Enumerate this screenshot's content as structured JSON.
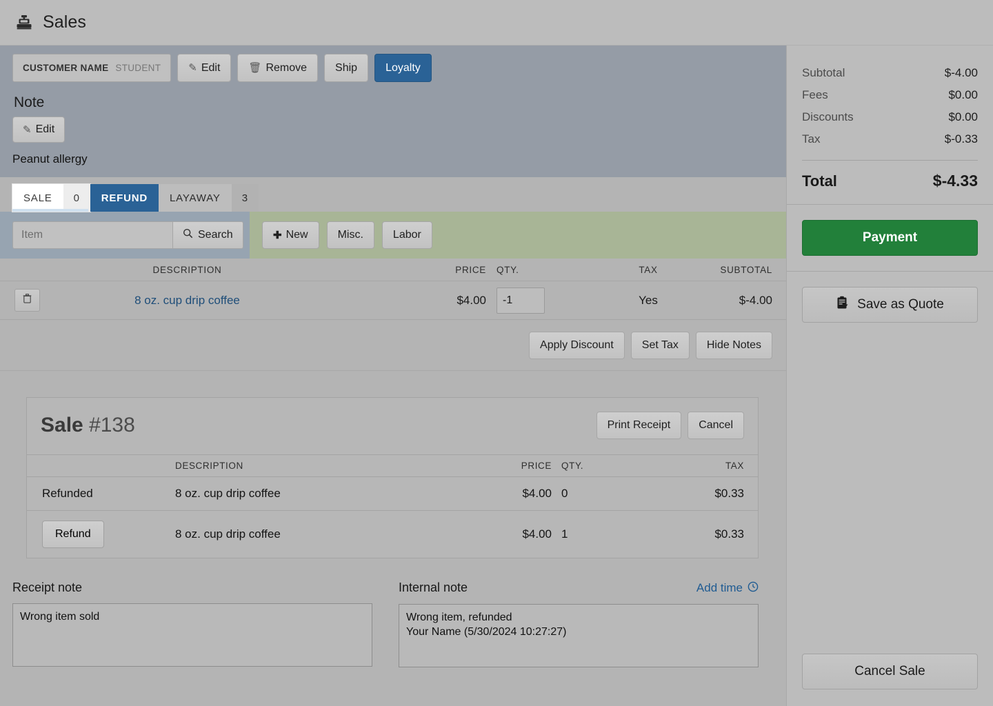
{
  "header": {
    "title": "Sales",
    "icon": "cash-register-icon"
  },
  "customer": {
    "field_label": "CUSTOMER NAME",
    "field_value": "STUDENT",
    "edit_label": "Edit",
    "remove_label": "Remove",
    "ship_label": "Ship",
    "loyalty_label": "Loyalty",
    "note_heading": "Note",
    "note_edit_label": "Edit",
    "note_text": "Peanut allergy"
  },
  "tabs": [
    {
      "label": "SALE",
      "count": "0",
      "state": "inactive"
    },
    {
      "label": "REFUND",
      "count": "",
      "state": "active"
    },
    {
      "label": "LAYAWAY",
      "count": "3",
      "state": "inactive"
    }
  ],
  "search": {
    "placeholder": "Item",
    "value": "",
    "button_label": "Search",
    "new_label": "New",
    "misc_label": "Misc.",
    "labor_label": "Labor"
  },
  "cart": {
    "columns": [
      "DESCRIPTION",
      "PRICE",
      "QTY.",
      "TAX",
      "SUBTOTAL"
    ],
    "rows": [
      {
        "description": "8 oz. cup drip coffee",
        "price": "$4.00",
        "qty": "-1",
        "tax": "Yes",
        "subtotal": "$-4.00"
      }
    ],
    "apply_discount_label": "Apply Discount",
    "set_tax_label": "Set Tax",
    "hide_notes_label": "Hide Notes"
  },
  "sale_panel": {
    "title_bold": "Sale",
    "title_number": "#138",
    "print_receipt_label": "Print Receipt",
    "cancel_label": "Cancel",
    "columns": [
      "",
      "DESCRIPTION",
      "PRICE",
      "QTY.",
      "TAX"
    ],
    "rows": [
      {
        "action": "Refunded",
        "action_is_button": false,
        "description": "8 oz. cup drip coffee",
        "price": "$4.00",
        "qty": "0",
        "tax": "$0.33"
      },
      {
        "action": "Refund",
        "action_is_button": true,
        "description": "8 oz. cup drip coffee",
        "price": "$4.00",
        "qty": "1",
        "tax": "$0.33"
      }
    ]
  },
  "notes": {
    "receipt_label": "Receipt note",
    "receipt_value": "Wrong item sold",
    "internal_label": "Internal note",
    "add_time_label": "Add time",
    "internal_value": "Wrong item, refunded\nYour Name (5/30/2024 10:27:27)"
  },
  "totals": {
    "lines": [
      {
        "key": "Subtotal",
        "value": "$-4.00"
      },
      {
        "key": "Fees",
        "value": "$0.00"
      },
      {
        "key": "Discounts",
        "value": "$0.00"
      },
      {
        "key": "Tax",
        "value": "$-0.33"
      }
    ],
    "total_key": "Total",
    "total_value": "$-4.33"
  },
  "sidebar_actions": {
    "payment_label": "Payment",
    "save_quote_label": "Save as Quote",
    "cancel_sale_label": "Cancel Sale"
  },
  "colors": {
    "accent_blue": "#2a6296",
    "accent_green": "#22803a",
    "link_blue": "#1f4e79",
    "customer_panel": "#959ca6",
    "search_panel": "#97a4b1",
    "actions_panel": "#a8b596",
    "body_bg": "#b4b4b4"
  }
}
